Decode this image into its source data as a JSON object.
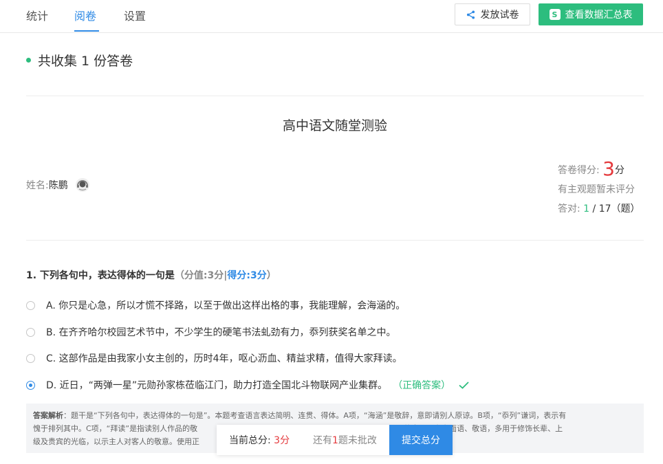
{
  "nav": {
    "tabs": [
      {
        "label": "统计"
      },
      {
        "label": "阅卷"
      },
      {
        "label": "设置"
      }
    ],
    "share_button": "发放试卷",
    "report_button": "查看数据汇总表",
    "report_badge": "S"
  },
  "summary": {
    "text": "共收集 1 份答卷"
  },
  "exam": {
    "title": "高中语文随堂测验"
  },
  "student": {
    "name_label": "姓名:",
    "name_value": "陈鹏"
  },
  "score": {
    "label": "答卷得分:",
    "value": "3",
    "unit": "分",
    "note": "有主观题暂未评分",
    "correct_label": "答对:",
    "correct_count": "1",
    "correct_total": "/ 17（题）"
  },
  "question": {
    "title": "1. 下列各句中，表达得体的一句是",
    "meta_open": "（分值:",
    "meta_value": "3分",
    "meta_sep": "|",
    "score_label": "得分:",
    "score_value": "3分",
    "meta_close": "）",
    "options": [
      {
        "text": "A. 你只是心急，所以才慌不择路，以至于做出这样出格的事，我能理解，会海涵的。",
        "checked": false
      },
      {
        "text": "B. 在齐齐哈尔校园艺术节中，不少学生的硬笔书法虬劲有力，忝列获奖名单之中。",
        "checked": false
      },
      {
        "text": "C. 这部作品是由我家小女主创的，历时4年，呕心沥血、精益求精，值得大家拜读。",
        "checked": false
      },
      {
        "text": "D. 近日，“两弹一星”元勋孙家栋莅临江门，助力打造全国北斗物联网产业集群。",
        "checked": true
      }
    ],
    "correct_tag": "（正确答案）",
    "analysis_label": "答案解析",
    "analysis_line1": "：题干是“下列各句中，表达得体的一句是”。本题考查语言表达简明、连贯、得体。A项，“海涵”是敬辞，意即请别人原谅。B项，“忝列”谦词，表示有",
    "analysis_line2": "愧于排列其中。C项，“拜读”是指读别人作品的敬",
    "analysis_line2_tail": "的意思。为书面语、敬语，多用于修饰长辈、上",
    "analysis_line3": "级及贵宾的光临，以示主人对客人的敬意。使用正"
  },
  "float_bar": {
    "total_label": "当前总分:",
    "total_value": "3分",
    "pending_prefix": "还有",
    "pending_count": "1",
    "pending_suffix": "题未批改",
    "submit_button": "提交总分"
  },
  "colors": {
    "accent_blue": "#2f8ae5",
    "accent_green": "#2dbd7e",
    "score_red": "#e4393c"
  }
}
